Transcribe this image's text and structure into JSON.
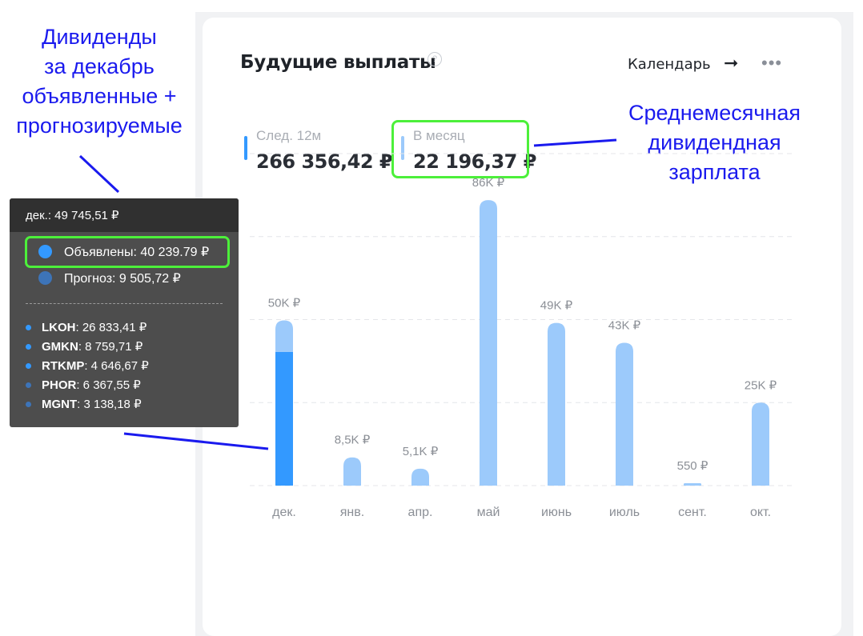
{
  "card": {
    "title": "Будущие выплаты",
    "help_icon": "?",
    "calendar_label": "Календарь",
    "calendar_arrow": "➞",
    "more_icon": "•••"
  },
  "stats": {
    "next12m": {
      "label": "След. 12м",
      "value": "266 356,42 ₽"
    },
    "per_month": {
      "label": "В месяц",
      "value": "22 196,37 ₽"
    }
  },
  "annotations": {
    "left": [
      "Дивиденды",
      "за декабрь",
      "объявленные +",
      "прогнозируемые"
    ],
    "right": [
      "Среднемесячная",
      "дивидендная",
      "зарплата"
    ]
  },
  "tooltip": {
    "header": "дек.: 49 745,51 ₽",
    "declared": "Объявлены: 40 239.79 ₽",
    "forecast": "Прогноз: 9 505,72 ₽",
    "tickers": [
      {
        "ticker": "LKOH",
        "value": ": 26 833,41 ₽",
        "kind": "declared"
      },
      {
        "ticker": "GMKN",
        "value": ": 8 759,71 ₽",
        "kind": "declared"
      },
      {
        "ticker": "RTKMP",
        "value": ": 4 646,67 ₽",
        "kind": "declared"
      },
      {
        "ticker": "PHOR",
        "value": ": 6 367,55 ₽",
        "kind": "forecast"
      },
      {
        "ticker": "MGNT",
        "value": ": 3 138,18 ₽",
        "kind": "forecast"
      }
    ]
  },
  "colors": {
    "declared": "#3399ff",
    "forecast": "#9ccafb",
    "forecast_dot": "#3d74b8",
    "accent": "#4cf03a",
    "annotation": "#1a1aee",
    "stat_bar_12m": "#3399ff",
    "stat_bar_month": "#9ccafb"
  },
  "chart_data": {
    "type": "bar",
    "stacked": true,
    "categories": [
      "дек.",
      "янв.",
      "апр.",
      "май",
      "июнь",
      "июль",
      "сент.",
      "окт."
    ],
    "series": [
      {
        "name": "Объявлены",
        "values": [
          40239.79,
          0,
          0,
          0,
          0,
          0,
          0,
          0
        ]
      },
      {
        "name": "Прогноз",
        "values": [
          9505.72,
          8500,
          5100,
          86000,
          49000,
          43000,
          550,
          25000
        ]
      }
    ],
    "totals": [
      49745.51,
      8500,
      5100,
      86000,
      49000,
      43000,
      550,
      25000
    ],
    "value_labels": [
      "50K ₽",
      "8,5K ₽",
      "5,1K ₽",
      "86K ₽",
      "49K ₽",
      "43K ₽",
      "550 ₽",
      "25K ₽"
    ],
    "ylim": [
      0,
      100000
    ],
    "grid": true
  }
}
